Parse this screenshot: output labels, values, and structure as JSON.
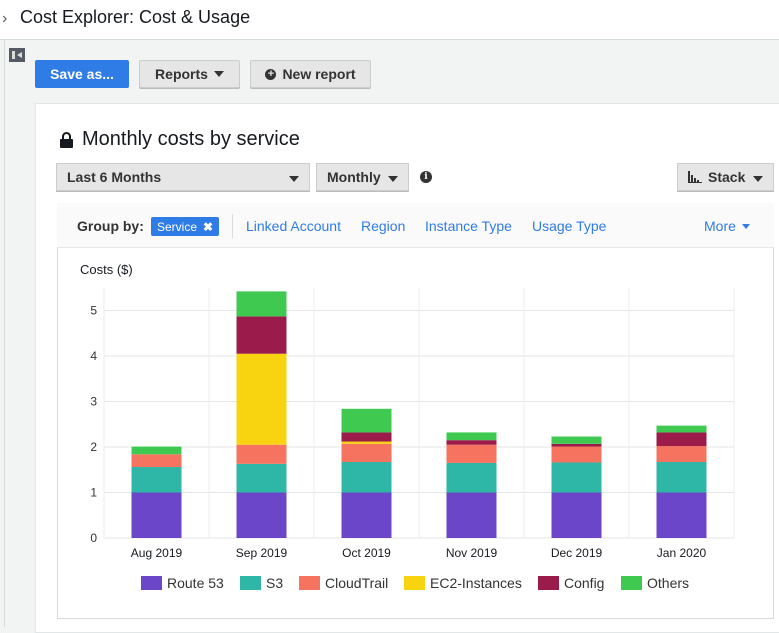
{
  "header": {
    "title": "Cost Explorer: Cost & Usage"
  },
  "toolbar": {
    "save_as": "Save as...",
    "reports": "Reports",
    "new_report": "New report"
  },
  "report": {
    "title": "Monthly costs by service",
    "time_range": "Last 6 Months",
    "granularity": "Monthly",
    "chart_style": "Stack"
  },
  "group_by": {
    "label": "Group by:",
    "selected": "Service",
    "options": [
      "Linked Account",
      "Region",
      "Instance Type",
      "Usage Type"
    ],
    "more": "More"
  },
  "colors": {
    "Route 53": "#6b46c9",
    "S3": "#2eb6a6",
    "CloudTrail": "#f6735f",
    "EC2-Instances": "#f8d310",
    "Config": "#9b1b4a",
    "Others": "#3fc951"
  },
  "chart_data": {
    "type": "bar",
    "stacked": true,
    "ylabel": "Costs ($)",
    "ylim": [
      0,
      5.5
    ],
    "yticks": [
      0,
      1,
      2,
      3,
      4,
      5
    ],
    "categories": [
      "Aug 2019",
      "Sep 2019",
      "Oct 2019",
      "Nov 2019",
      "Dec 2019",
      "Jan 2020"
    ],
    "series": [
      {
        "name": "Route 53",
        "values": [
          1.0,
          1.0,
          1.0,
          1.0,
          1.0,
          1.0
        ]
      },
      {
        "name": "S3",
        "values": [
          0.56,
          0.63,
          0.67,
          0.65,
          0.66,
          0.67
        ]
      },
      {
        "name": "CloudTrail",
        "values": [
          0.28,
          0.42,
          0.4,
          0.4,
          0.35,
          0.35
        ]
      },
      {
        "name": "EC2-Instances",
        "values": [
          0.0,
          2.0,
          0.05,
          0.0,
          0.0,
          0.0
        ]
      },
      {
        "name": "Config",
        "values": [
          0.0,
          0.82,
          0.2,
          0.1,
          0.06,
          0.3
        ]
      },
      {
        "name": "Others",
        "values": [
          0.17,
          0.55,
          0.52,
          0.17,
          0.16,
          0.15
        ]
      }
    ],
    "legend_position": "bottom",
    "grid": true
  }
}
